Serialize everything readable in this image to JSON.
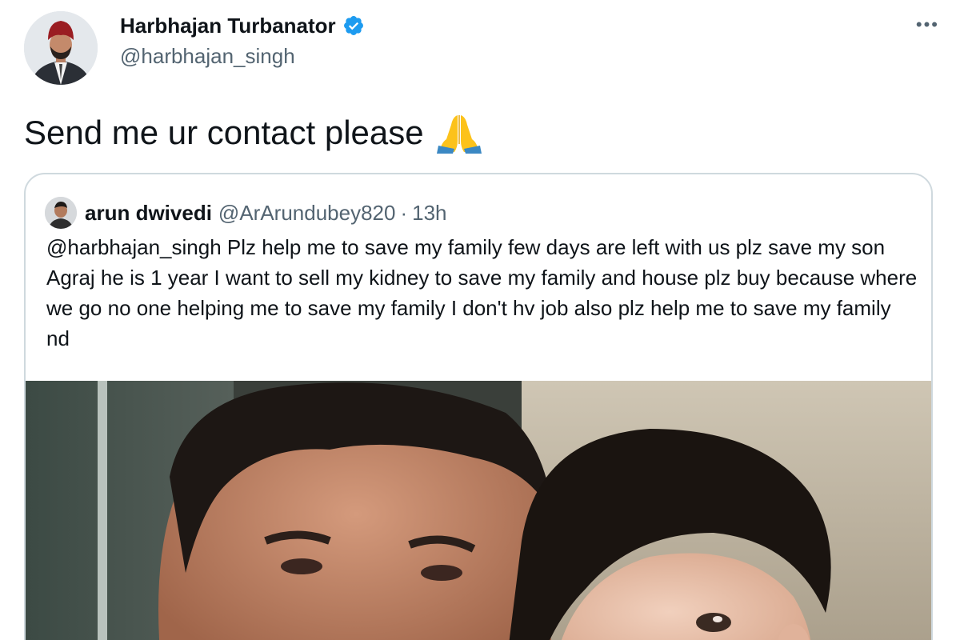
{
  "tweet": {
    "author": {
      "name": "Harbhajan Turbanator",
      "handle": "@harbhajan_singh",
      "verified": true,
      "avatar_icon": "person-avatar"
    },
    "more_label": "•••",
    "text": "Send me ur contact please",
    "emoji_icon": "folded-hands-icon"
  },
  "quote": {
    "author": {
      "name": "arun dwivedi",
      "handle": "@ArArundubey820",
      "separator": "·",
      "time": "13h"
    },
    "text": "@harbhajan_singh Plz help me to save  my family few days are left with us plz save my son Agraj he is 1 year I want to sell my kidney to save my family and house plz buy because where we go no one helping me to save my family I don't hv job also plz help me to save my family nd",
    "media_icon": "photo-man-and-child"
  },
  "colors": {
    "text": "#0f1419",
    "secondary": "#536471",
    "verified": "#1d9bf0",
    "border": "#cfd9de"
  }
}
